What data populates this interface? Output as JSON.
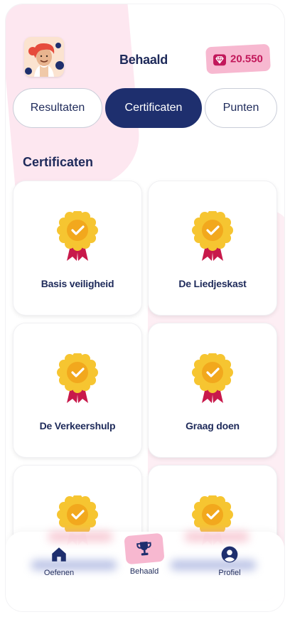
{
  "header": {
    "title": "Behaald",
    "points": "20.550",
    "points_icon": "diamond-icon",
    "avatar": "avatar"
  },
  "tabs": [
    {
      "label": "Resultaten",
      "active": false
    },
    {
      "label": "Certificaten",
      "active": true
    },
    {
      "label": "Punten",
      "active": false
    }
  ],
  "section": {
    "title": "Certificaten"
  },
  "certificates": [
    {
      "label": "Basis veiligheid",
      "icon": "rosette-check-icon"
    },
    {
      "label": "De Liedjeskast",
      "icon": "rosette-check-icon"
    },
    {
      "label": "De Verkeershulp",
      "icon": "rosette-check-icon"
    },
    {
      "label": "Graag doen",
      "icon": "rosette-check-icon"
    },
    {
      "label": "",
      "icon": "rosette-check-icon"
    },
    {
      "label": "",
      "icon": "rosette-check-icon"
    }
  ],
  "nav": [
    {
      "label": "Oefenen",
      "icon": "home-icon",
      "active": false
    },
    {
      "label": "Behaald",
      "icon": "trophy-icon",
      "active": true
    },
    {
      "label": "Profiel",
      "icon": "profile-icon",
      "active": false
    }
  ],
  "colors": {
    "navy": "#1e2f6e",
    "pink": "#f7b8d0",
    "pink_text": "#c2185b",
    "gold": "#f6c531",
    "ribbon": "#c8194b"
  }
}
